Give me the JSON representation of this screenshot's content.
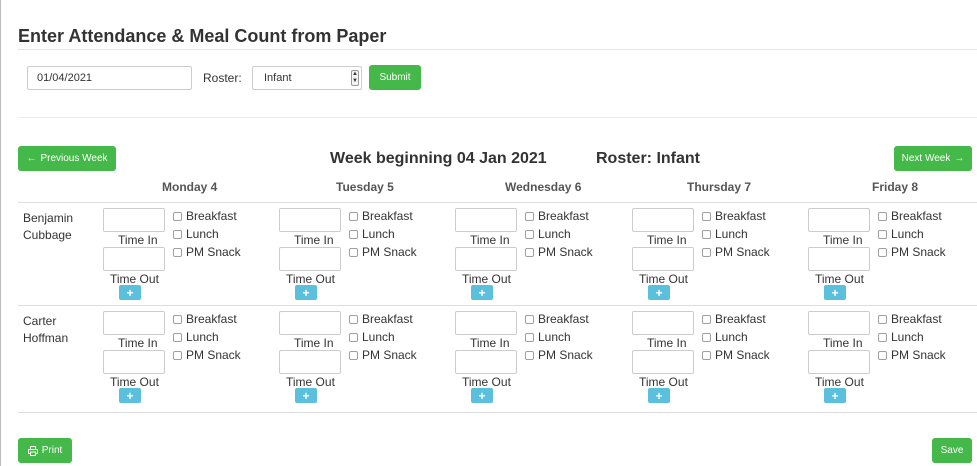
{
  "page": {
    "title": "Enter Attendance & Meal Count from Paper"
  },
  "form": {
    "date_value": "01/04/2021",
    "roster_label": "Roster:",
    "roster_selected": "Infant",
    "submit_label": "Submit"
  },
  "week": {
    "prev_label": "Previous Week",
    "next_label": "Next Week",
    "title": "Week beginning 04 Jan 2021",
    "roster_title": "Roster: Infant",
    "days": [
      "Monday 4",
      "Tuesday 5",
      "Wednesday 6",
      "Thursday 7",
      "Friday 8"
    ]
  },
  "labels": {
    "time_in": "Time In",
    "time_out": "Time Out",
    "add": "+",
    "meals": [
      "Breakfast",
      "Lunch",
      "PM Snack"
    ]
  },
  "children": [
    {
      "first": "Benjamin",
      "last": "Cubbage"
    },
    {
      "first": "Carter",
      "last": "Hoffman"
    }
  ],
  "footer": {
    "print_label": "Print",
    "save_label": "Save"
  },
  "icons": {
    "prev": "arrow-left-icon",
    "next": "arrow-right-icon",
    "print": "printer-icon",
    "roster_dropdown": "select-arrow-icon"
  },
  "colors": {
    "primary_green": "#44b848",
    "info_blue": "#5bc0de"
  }
}
